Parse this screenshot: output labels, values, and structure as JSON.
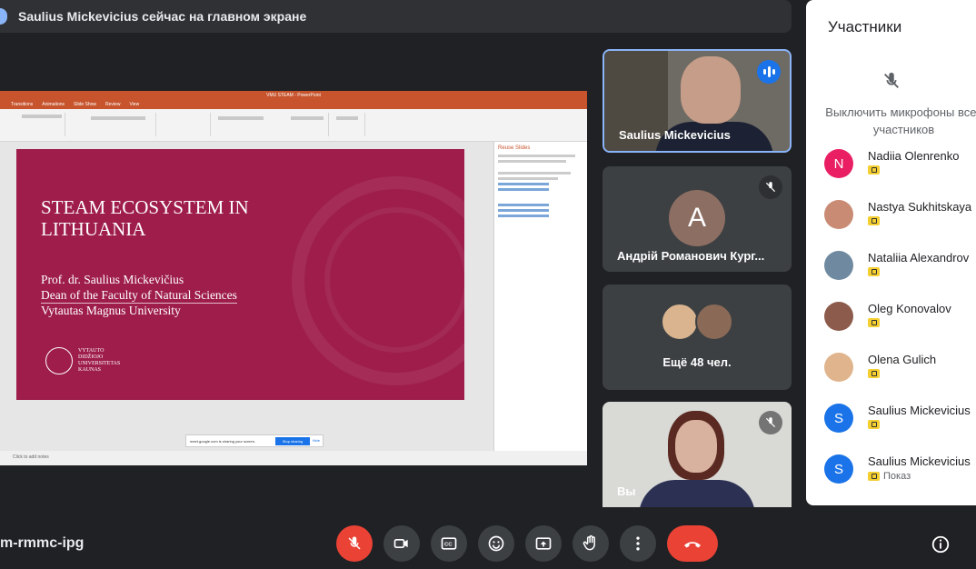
{
  "banner": {
    "text": "Saulius Mickevicius сейчас на главном экране"
  },
  "presentation": {
    "window_title": "VMU STEAM - PowerPoint",
    "ribbon_tabs": [
      "Transitions",
      "Animations",
      "Slide Show",
      "Review",
      "View"
    ],
    "slide": {
      "title": "STEAM ECOSYSTEM IN LITHUANIA",
      "lines": [
        "Prof. dr. Saulius Mickevičius",
        "Dean of the Faculty of Natural Sciences",
        "Vytautas Magnus University"
      ],
      "logo_text": [
        "VYTAUTO",
        "DIDŽIOJO",
        "UNIVERSITETAS",
        "KAUNAS"
      ]
    },
    "side_pane_title": "Reuse Slides",
    "notes_placeholder": "Click to add notes",
    "share_bar": {
      "text": "meet.google.com is sharing your screen.",
      "stop_label": "Stop sharing",
      "hide_label": "Hide"
    }
  },
  "tiles": {
    "speaker_name": "Saulius Mickevicius",
    "participant2_name": "Андрій Романович Кург...",
    "participant2_initial": "A",
    "more_label": "Ещё 48 чел.",
    "self_label": "Вы"
  },
  "panel": {
    "title": "Участники",
    "mute_all_label": "Выключить микрофоны всех участников",
    "participants": [
      {
        "name": "Nadiia Olenrenko",
        "initial": "N",
        "color": "#e91e63",
        "badge": ""
      },
      {
        "name": "Nastya Sukhitskaya",
        "initial": "",
        "color": "#c98b73",
        "badge": ""
      },
      {
        "name": "Nataliia Alexandrov",
        "initial": "",
        "color": "#6f8aa0",
        "badge": ""
      },
      {
        "name": "Oleg Konovalov",
        "initial": "",
        "color": "#8d5b4c",
        "badge": ""
      },
      {
        "name": "Olena Gulich",
        "initial": "",
        "color": "#e0b48d",
        "badge": ""
      },
      {
        "name": "Saulius Mickevicius",
        "initial": "S",
        "color": "#1a73e8",
        "badge": ""
      },
      {
        "name": "Saulius Mickevicius",
        "initial": "S",
        "color": "#1a73e8",
        "badge": "Показ"
      }
    ]
  },
  "bottom": {
    "meeting_code": "m-rmmc-ipg"
  },
  "colors": {
    "slide_bg": "#9e1d4a",
    "accent": "#1a73e8",
    "danger": "#ea4335",
    "ppt_orange": "#c7542d"
  }
}
